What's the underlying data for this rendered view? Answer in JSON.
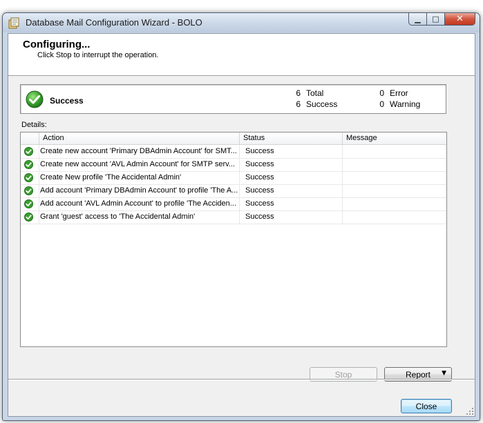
{
  "window": {
    "title": "Database Mail Configuration Wizard - BOLO",
    "controls": {
      "minimize": "minimize",
      "maximize": "maximize",
      "close": "close"
    }
  },
  "header": {
    "title": "Configuring...",
    "subtitle": "Click Stop to interrupt the operation."
  },
  "summary": {
    "status": "Success",
    "stats": {
      "total_count": "6",
      "total_label": "Total",
      "success_count": "6",
      "success_label": "Success",
      "error_count": "0",
      "error_label": "Error",
      "warning_count": "0",
      "warning_label": "Warning"
    }
  },
  "details": {
    "label": "Details:",
    "columns": {
      "action": "Action",
      "status": "Status",
      "message": "Message"
    },
    "rows": [
      {
        "action": "Create new account 'Primary DBAdmin Account' for SMT...",
        "status": "Success",
        "message": ""
      },
      {
        "action": "Create new account 'AVL Admin Account' for SMTP serv...",
        "status": "Success",
        "message": ""
      },
      {
        "action": "Create New profile 'The Accidental Admin'",
        "status": "Success",
        "message": ""
      },
      {
        "action": "Add account 'Primary DBAdmin Account' to profile 'The A...",
        "status": "Success",
        "message": ""
      },
      {
        "action": "Add account 'AVL Admin Account' to profile 'The Acciden...",
        "status": "Success",
        "message": ""
      },
      {
        "action": "Grant 'guest' access to 'The Accidental Admin'",
        "status": "Success",
        "message": ""
      }
    ]
  },
  "buttons": {
    "stop": "Stop",
    "report": "Report",
    "close": "Close"
  },
  "icons": {
    "success": "check-circle-icon",
    "app": "app-icon"
  },
  "colors": {
    "success_green": "#3aa02f",
    "focus_blue": "#3c7fb1"
  }
}
